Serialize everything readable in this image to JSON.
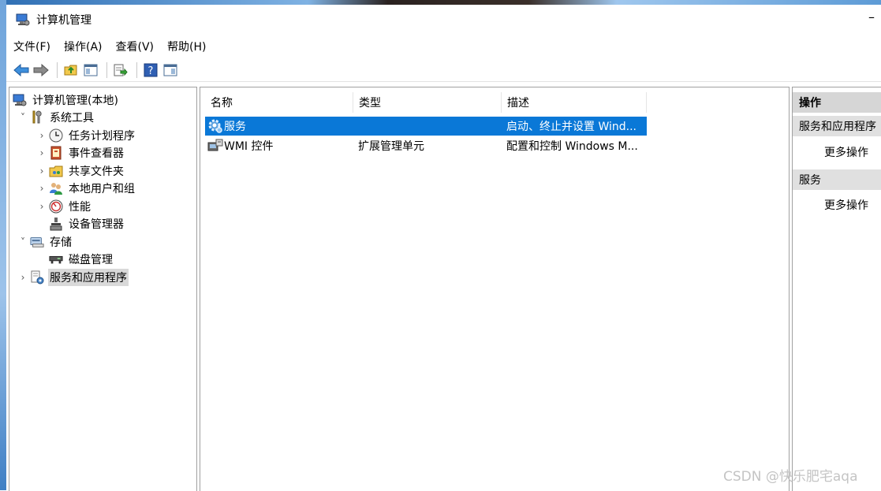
{
  "window": {
    "title": "计算机管理",
    "minimize_glyph": "–"
  },
  "menu": [
    "文件(F)",
    "操作(A)",
    "查看(V)",
    "帮助(H)"
  ],
  "toolbar_icons": [
    "back-arrow-icon",
    "forward-arrow-icon",
    "folder-up-icon",
    "show-hide-tree-icon",
    "export-list-icon",
    "help-icon",
    "action-pane-icon"
  ],
  "tree": [
    {
      "label": "计算机管理(本地)",
      "icon": "computer-management-icon",
      "level": 0,
      "expander": ""
    },
    {
      "label": "系统工具",
      "icon": "system-tools-icon",
      "level": 1,
      "expander": "˅"
    },
    {
      "label": "任务计划程序",
      "icon": "task-scheduler-icon",
      "level": 2,
      "expander": "›"
    },
    {
      "label": "事件查看器",
      "icon": "event-viewer-icon",
      "level": 2,
      "expander": "›"
    },
    {
      "label": "共享文件夹",
      "icon": "shared-folders-icon",
      "level": 2,
      "expander": "›"
    },
    {
      "label": "本地用户和组",
      "icon": "local-users-icon",
      "level": 2,
      "expander": "›"
    },
    {
      "label": "性能",
      "icon": "performance-icon",
      "level": 2,
      "expander": "›"
    },
    {
      "label": "设备管理器",
      "icon": "device-manager-icon",
      "level": 2,
      "expander": ""
    },
    {
      "label": "存储",
      "icon": "storage-icon",
      "level": 1,
      "expander": "˅"
    },
    {
      "label": "磁盘管理",
      "icon": "disk-management-icon",
      "level": 2,
      "expander": ""
    },
    {
      "label": "服务和应用程序",
      "icon": "services-apps-icon",
      "level": 1,
      "expander": "›"
    }
  ],
  "list": {
    "columns": [
      "名称",
      "类型",
      "描述"
    ],
    "rows": [
      {
        "name": "服务",
        "type": "",
        "desc": "启动、终止并设置 Wind...",
        "icon": "services-gear-icon"
      },
      {
        "name": "WMI 控件",
        "type": "扩展管理单元",
        "desc": "配置和控制 Windows M...",
        "icon": "wmi-control-icon"
      }
    ]
  },
  "actions": {
    "header": "操作",
    "sections": [
      {
        "title": "服务和应用程序",
        "item": "更多操作"
      },
      {
        "title": "服务",
        "item": "更多操作"
      }
    ]
  },
  "watermark": "CSDN @快乐肥宅aqa",
  "colors": {
    "selection": "#0a78d7",
    "tree_selection": "#d9d9d9",
    "action_header": "#e0e0e0"
  }
}
